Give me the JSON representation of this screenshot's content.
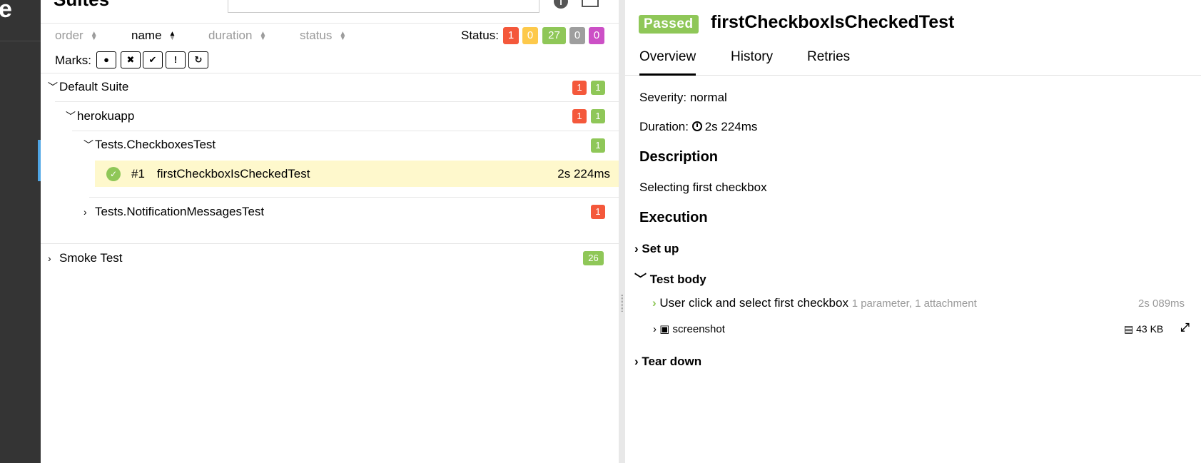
{
  "app": {
    "brand_fragment": "e",
    "panel_title_fragment": "Suites"
  },
  "sorters": {
    "order": "order",
    "name": "name",
    "duration": "duration",
    "status": "status"
  },
  "status_filter": {
    "label": "Status:",
    "counts": {
      "failed": "1",
      "broken": "0",
      "passed": "27",
      "skipped": "0",
      "unknown": "0"
    }
  },
  "marks": {
    "label": "Marks:",
    "icons": [
      "flaky-bomb-icon",
      "new-failed-icon",
      "new-passed-icon",
      "new-broken-icon",
      "retries-icon"
    ]
  },
  "tree": {
    "default_suite": {
      "label": "Default Suite",
      "failed": "1",
      "passed": "1"
    },
    "herokuapp": {
      "label": "herokuapp",
      "failed": "1",
      "passed": "1"
    },
    "checkboxes": {
      "label": "Tests.CheckboxesTest",
      "passed": "1"
    },
    "test": {
      "num": "#1",
      "name": "firstCheckboxIsCheckedTest",
      "duration": "2s 224ms"
    },
    "notifications": {
      "label": "Tests.NotificationMessagesTest",
      "failed": "1"
    },
    "smoke": {
      "label": "Smoke Test",
      "passed": "26"
    }
  },
  "detail": {
    "status": "Passed",
    "title": "firstCheckboxIsCheckedTest",
    "tabs": [
      "Overview",
      "History",
      "Retries"
    ],
    "severity": "Severity: normal",
    "duration_label": "Duration:",
    "duration_value": "2s 224ms",
    "description_heading": "Description",
    "description": "Selecting first checkbox",
    "execution_heading": "Execution",
    "setup": "Set up",
    "test_body": "Test body",
    "step": {
      "label": "User click and select first checkbox",
      "meta": "1 parameter, 1 attachment",
      "duration": "2s 089ms"
    },
    "attachment": {
      "name": "screenshot",
      "size": "43 KB"
    },
    "teardown": "Tear down"
  },
  "colors": {
    "failed": "#f4583b",
    "broken": "#fdc94b",
    "passed": "#8fc758",
    "skipped": "#9e9e9e",
    "unknown": "#cc50c6",
    "selected_row": "#fef8cc"
  }
}
